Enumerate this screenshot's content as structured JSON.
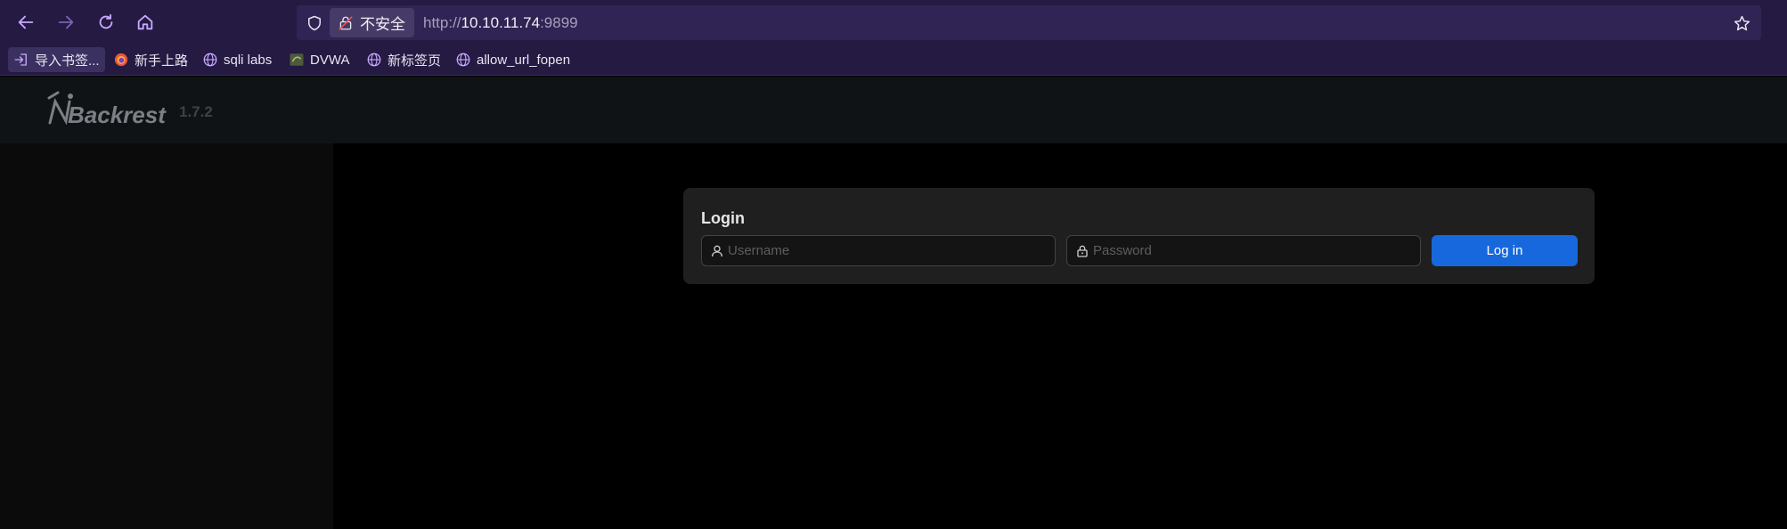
{
  "browser": {
    "url": {
      "security_label": "不安全",
      "scheme": "http://",
      "host": "10.10.11.74",
      "port": ":9899"
    },
    "bookmarks": [
      {
        "label": "导入书签...",
        "icon": "import-icon"
      },
      {
        "label": "新手上路",
        "icon": "firefox-icon"
      },
      {
        "label": "sqli labs",
        "icon": "globe-icon"
      },
      {
        "label": "DVWA",
        "icon": "dvwa-favicon"
      },
      {
        "label": "新标签页",
        "icon": "globe-icon"
      },
      {
        "label": "allow_url_fopen",
        "icon": "globe-icon"
      }
    ],
    "colors": {
      "chrome_bg": "#241a42",
      "urlbar_bg": "#2f2454",
      "accent_icon": "#c9a8ff"
    }
  },
  "app": {
    "logo_text": "Backrest",
    "version": "1.7.2",
    "login": {
      "title": "Login",
      "username_placeholder": "Username",
      "password_placeholder": "Password",
      "submit_label": "Log in"
    },
    "colors": {
      "primary": "#1668dc",
      "card_bg": "#1f1f1f",
      "header_bg": "#101316"
    }
  }
}
